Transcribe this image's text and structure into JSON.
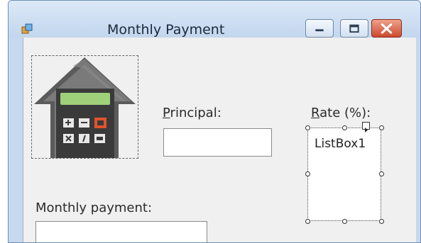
{
  "window": {
    "title": "Monthly Payment",
    "caption_buttons": [
      {
        "name": "minimize-button",
        "icon": "minimize-icon"
      },
      {
        "name": "maximize-button",
        "icon": "maximize-icon"
      },
      {
        "name": "close-button",
        "icon": "close-icon"
      }
    ]
  },
  "form": {
    "principal_label_accel": "P",
    "principal_label_rest": "rincipal:",
    "principal_value": "",
    "rate_label_accel": "R",
    "rate_label_rest": "ate (%):",
    "rate_list_item": "ListBox1",
    "monthly_payment_label": "Monthly payment:",
    "monthly_payment_value": ""
  },
  "icons": {
    "picture": "house-calculator-icon",
    "app": "form-app-icon"
  },
  "colors": {
    "close_button": "#cc4a2d",
    "house": "#5a5a5a",
    "calculator_display": "#9fd07a",
    "calculator_accent_key": "#e0532c"
  }
}
